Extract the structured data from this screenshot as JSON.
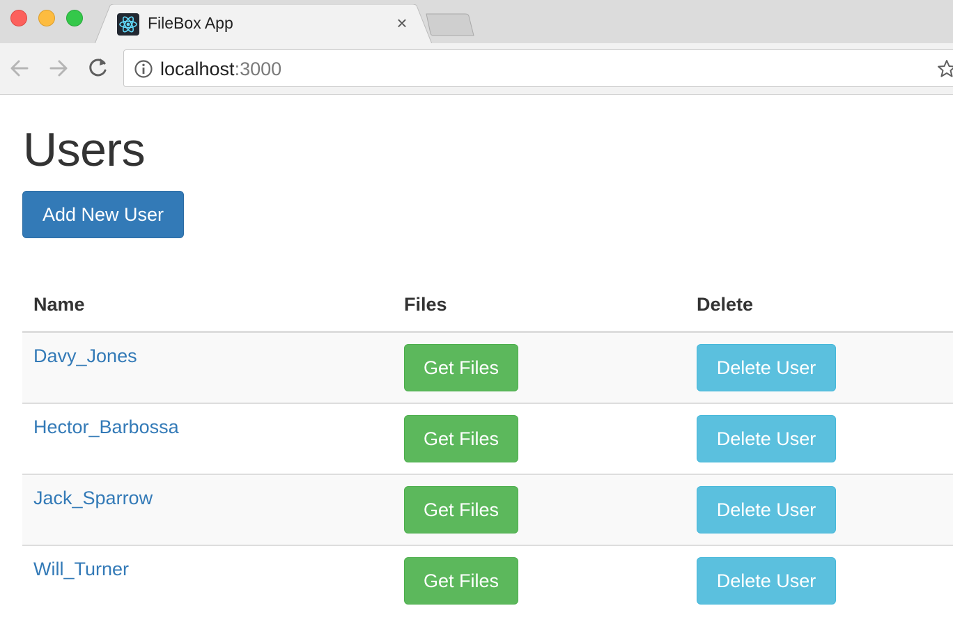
{
  "browser": {
    "tab": {
      "title": "FileBox App",
      "favicon": "react-icon",
      "close_icon": "close-icon"
    },
    "toolbar": {
      "back_icon": "back-arrow-icon",
      "forward_icon": "forward-arrow-icon",
      "reload_icon": "reload-icon",
      "url_host": "localhost",
      "url_port": ":3000",
      "info_icon": "info-icon",
      "bookmark_icon": "star-icon"
    }
  },
  "page": {
    "title": "Users",
    "add_button": "Add New User",
    "table": {
      "headers": {
        "name": "Name",
        "files": "Files",
        "delete": "Delete"
      },
      "rows": [
        {
          "name": "Davy_Jones",
          "files_button": "Get Files",
          "delete_button": "Delete User"
        },
        {
          "name": "Hector_Barbossa",
          "files_button": "Get Files",
          "delete_button": "Delete User"
        },
        {
          "name": "Jack_Sparrow",
          "files_button": "Get Files",
          "delete_button": "Delete User"
        },
        {
          "name": "Will_Turner",
          "files_button": "Get Files",
          "delete_button": "Delete User"
        }
      ]
    }
  },
  "colors": {
    "primary": "#337ab7",
    "success": "#5cb85c",
    "info": "#5bc0de",
    "link": "#337ab7"
  }
}
